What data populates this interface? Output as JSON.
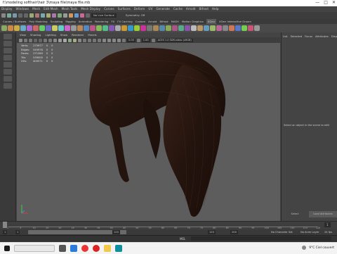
{
  "window": {
    "title": "f:\\modeling softhair\\hair 3\\maya file\\maya file.mb",
    "controls": [
      "—",
      "□",
      "✕"
    ]
  },
  "menubar": [
    "Display",
    "Windows",
    "Mesh",
    "Edit Mesh",
    "Mesh Tools",
    "Mesh Display",
    "Curves",
    "Surfaces",
    "Deform",
    "UV",
    "Generate",
    "Cache",
    "Arnold",
    "Bifrost",
    "Help"
  ],
  "top_toolbar": {
    "live_surface": "No Live Surface",
    "symmetry": "Symmetry: Off"
  },
  "shelf_tabs": [
    "Curves / Surfaces",
    "Poly Modeling",
    "Sculpting",
    "Rigging",
    "Animation",
    "Rendering",
    "FX",
    "FX Caching",
    "Custom",
    "Arnold",
    "Bifrost",
    "MASH",
    "Motion Graphics",
    "XGen",
    "XGen Interactive Groom"
  ],
  "active_shelf_tab": "XGen",
  "viewport": {
    "menu": [
      "View",
      "Shading",
      "Lighting",
      "Show",
      "Renderer",
      "Panels"
    ],
    "fields": [
      "0.00",
      "1.00"
    ],
    "color_space": "ACES 1.0 SDR-video (sRGB)",
    "hud": [
      {
        "label": "Verts:",
        "a": "275977",
        "b": "0",
        "c": "0"
      },
      {
        "label": "Edges:",
        "a": "545978",
        "b": "0",
        "c": "0"
      },
      {
        "label": "Faces:",
        "a": "271260",
        "b": "0",
        "c": "0"
      },
      {
        "label": "Tris:",
        "a": "539000",
        "b": "0",
        "c": "0"
      },
      {
        "label": "UVs:",
        "a": "400571",
        "b": "0",
        "c": "0"
      }
    ]
  },
  "right_panel": {
    "tabs": [
      "List",
      "Selected",
      "Focus",
      "Attributes",
      "Display"
    ],
    "message": "Select an object in the scene to edit",
    "buttons": [
      "Select",
      "Load Attributes"
    ]
  },
  "time_slider": {
    "ticks": [
      "1",
      "5",
      "10",
      "15",
      "20",
      "25",
      "30",
      "35",
      "40",
      "45",
      "50",
      "55",
      "60",
      "65",
      "70",
      "75",
      "80",
      "85",
      "90",
      "95",
      "100",
      "105",
      "110",
      "115",
      "120"
    ],
    "current_frame": "1"
  },
  "range": {
    "start": "1",
    "inner_start": "1",
    "inner_end": "120",
    "end": "120",
    "end2": "200",
    "character_set": "No Character Set",
    "anim_layer": "No Anim Layer",
    "fps": "24 fps"
  },
  "command_line": {
    "lang": "MEL"
  },
  "taskbar": {
    "weather": "9°C  Ciel couvert",
    "icons": [
      "start-icon",
      "search-icon",
      "taskview-icon",
      "edge-icon",
      "chrome-icon",
      "opera-icon",
      "explorer-icon",
      "maya-icon"
    ]
  },
  "colors": {
    "hair": "#2a1812",
    "viewport_bg": "#5d5d5d",
    "active_button": "#5a5a5a"
  }
}
